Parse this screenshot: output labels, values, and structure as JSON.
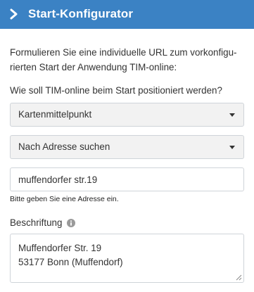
{
  "header": {
    "title": "Start-Konfigurator"
  },
  "intro": {
    "text": "Formulieren Sie eine individuelle URL zum vorkonfigu-rierten Start der Anwendung TIM-online:"
  },
  "position": {
    "question": "Wie soll TIM-online beim Start positioniert werden?",
    "center_select": "Kartenmittelpunkt",
    "mode_select": "Nach Adresse suchen",
    "address_value": "muffendorfer str.19",
    "address_help": "Bitte geben Sie eine Adresse ein."
  },
  "caption": {
    "label": "Beschriftung",
    "lines": [
      "Muffendorfer Str. 19",
      "53177 Bonn (Muffendorf)"
    ]
  },
  "colors": {
    "header_bg": "#3b82c4",
    "select_bg": "#f2f2f2",
    "border": "#cfd4d9",
    "info_icon": "#9a9a9a"
  },
  "icons": {
    "header": "chevron-right-icon",
    "select_caret": "caret-down-icon",
    "label_info": "info-icon",
    "textarea_resize": "resize-grip-icon"
  }
}
